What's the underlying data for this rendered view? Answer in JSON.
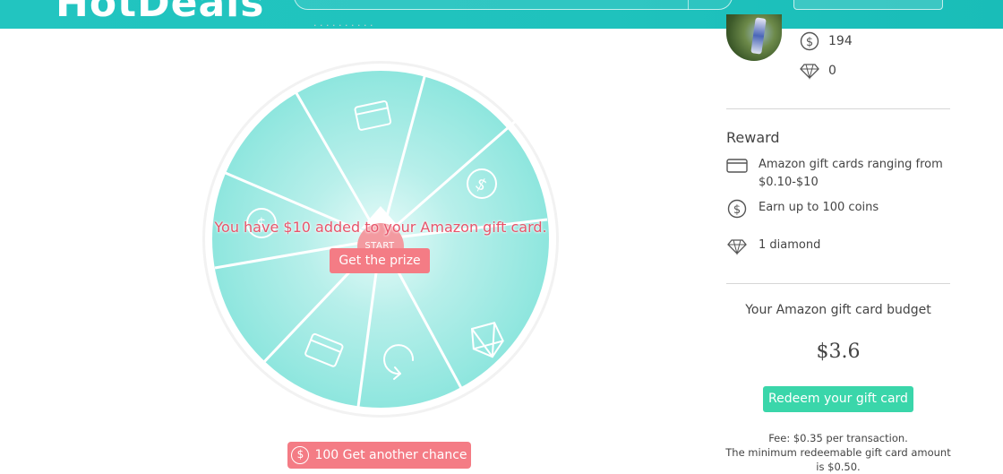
{
  "header": {
    "logo_text": "HotDeals",
    "faded_subtitle": "· · · · · · · · · ·"
  },
  "wheel": {
    "result_message": "You have $10 added to your Amazon gift card.",
    "get_prize_label": "Get the prize",
    "start_label": "START",
    "segments": [
      "gift-card-icon",
      "dollar-icon",
      "diamond-icon",
      "retry-icon",
      "gift-card-icon",
      "blank",
      "dollar-icon",
      "blank"
    ]
  },
  "chance": {
    "coin_symbol": "$",
    "label": "100 Get another chance"
  },
  "user": {
    "coins": "194",
    "diamonds": "0"
  },
  "reward": {
    "title": "Reward",
    "items": [
      {
        "icon": "gift-card-icon",
        "text": "Amazon gift cards ranging from $0.10-$10"
      },
      {
        "icon": "coin-icon",
        "text": "Earn up to 100 coins"
      },
      {
        "icon": "diamond-icon",
        "text": "1 diamond"
      }
    ]
  },
  "budget": {
    "title": "Your Amazon gift card budget",
    "amount": "$3.6",
    "redeem_label": "Redeem your gift card",
    "fee_line1": "Fee: $0.35 per transaction.",
    "fee_line2": "The minimum redeemable gift card amount is $0.50."
  },
  "colors": {
    "brand_teal": "#1fc2bd",
    "wheel_fill": "#8ee6de",
    "button_pink": "#f47c85",
    "redeem_green": "#3ad6aa",
    "message_red": "#e8546a"
  }
}
